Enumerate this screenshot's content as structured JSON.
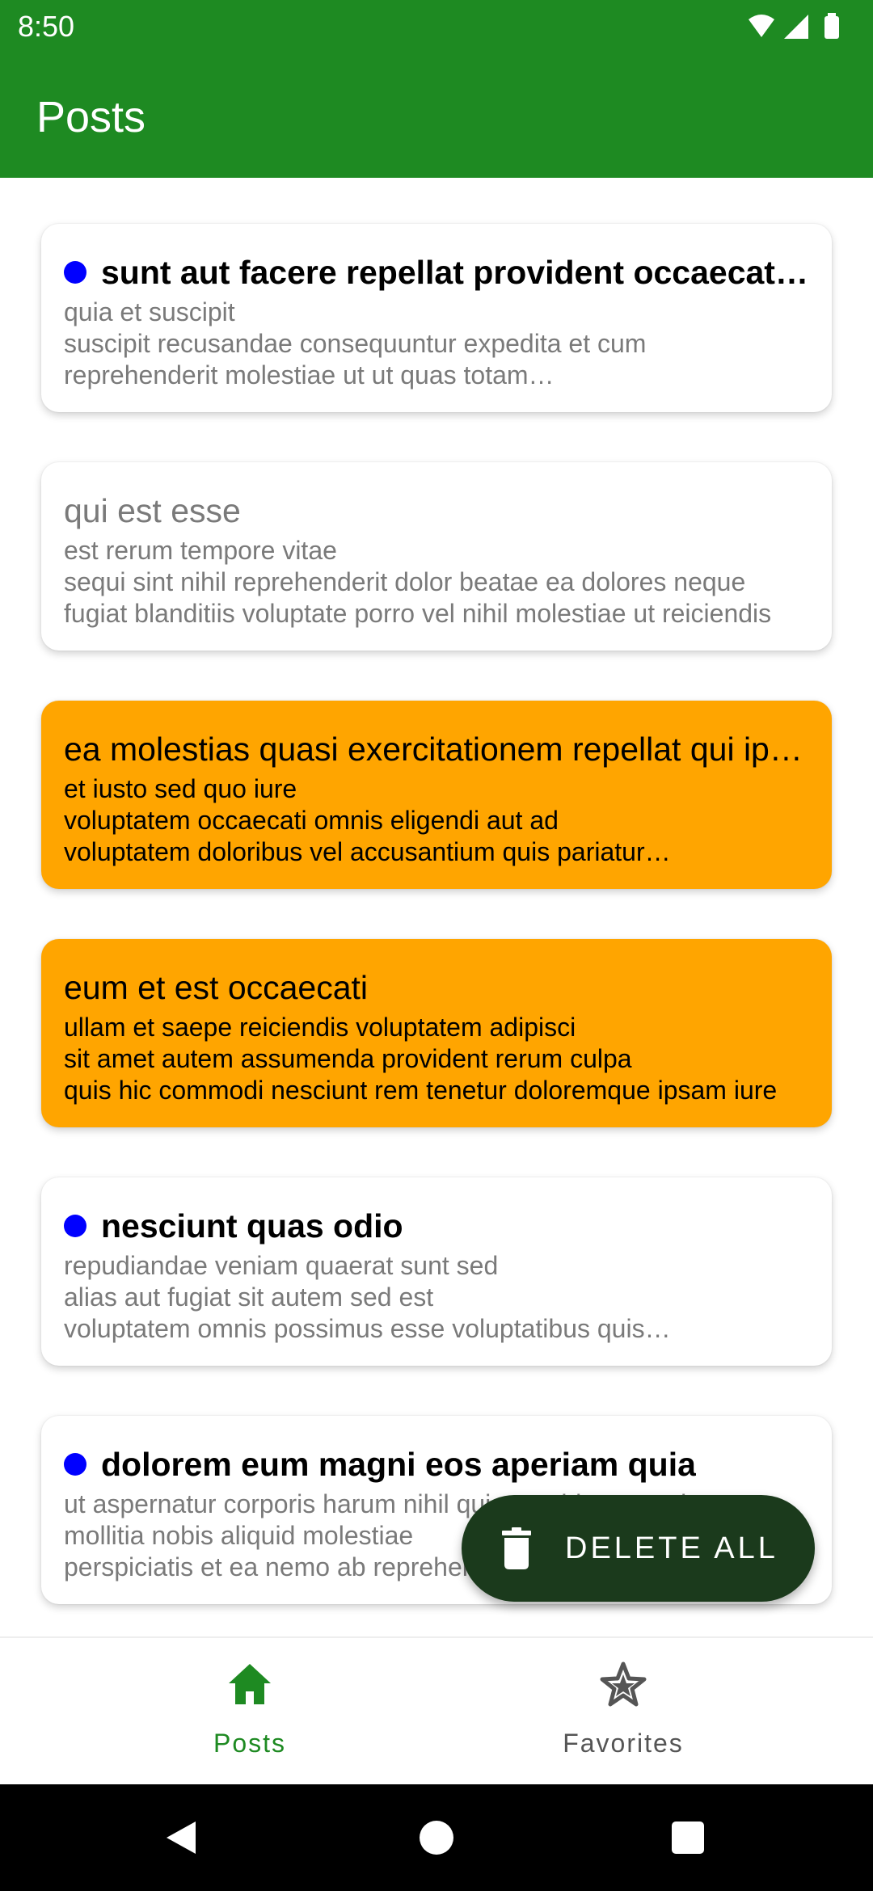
{
  "status_bar": {
    "time": "8:50",
    "icons": [
      "wifi-icon",
      "signal-icon",
      "battery-icon"
    ]
  },
  "app_bar": {
    "title": "Posts"
  },
  "posts": [
    {
      "title": "sunt aut facere repellat provident occaecati excepturi optio reprehenderit",
      "body": "quia et suscipit\nsuscipit recusandae consequuntur expedita et cum\nreprehenderit molestiae ut ut quas totam…",
      "state": "unread"
    },
    {
      "title": "qui est esse",
      "body": "est rerum tempore vitae\nsequi sint nihil reprehenderit dolor beatae ea dolores neque\nfugiat blanditiis voluptate porro vel nihil molestiae ut reiciendis",
      "state": "read"
    },
    {
      "title": "ea molestias quasi exercitationem repellat qui ipsa sit aut",
      "body": "et iusto sed quo iure\nvoluptatem occaecati omnis eligendi aut ad\nvoluptatem doloribus vel accusantium quis pariatur…",
      "state": "highlighted"
    },
    {
      "title": "eum et est occaecati",
      "body": "ullam et saepe reiciendis voluptatem adipisci\nsit amet autem assumenda provident rerum culpa\nquis hic commodi nesciunt rem tenetur doloremque ipsam iure",
      "state": "highlighted"
    },
    {
      "title": "nesciunt quas odio",
      "body": "repudiandae veniam quaerat sunt sed\nalias aut fugiat sit autem sed est\nvoluptatem omnis possimus esse voluptatibus quis…",
      "state": "unread"
    },
    {
      "title": "dolorem eum magni eos aperiam quia",
      "body": "ut aspernatur corporis harum nihil quis provident sequi\nmollitia nobis aliquid molestiae\nperspiciatis et ea nemo ab reprehenderit accusantium quas",
      "state": "unread"
    }
  ],
  "fab": {
    "label": "DELETE ALL",
    "icon": "trash-icon"
  },
  "bottom_nav": [
    {
      "label": "Posts",
      "icon": "home-icon",
      "selected": true
    },
    {
      "label": "Favorites",
      "icon": "star-icon",
      "selected": false
    }
  ],
  "colors": {
    "primary": "#1e8a22",
    "highlight": "#ffa500",
    "unread_dot": "#0000ff",
    "fab": "#1b3a1c"
  }
}
